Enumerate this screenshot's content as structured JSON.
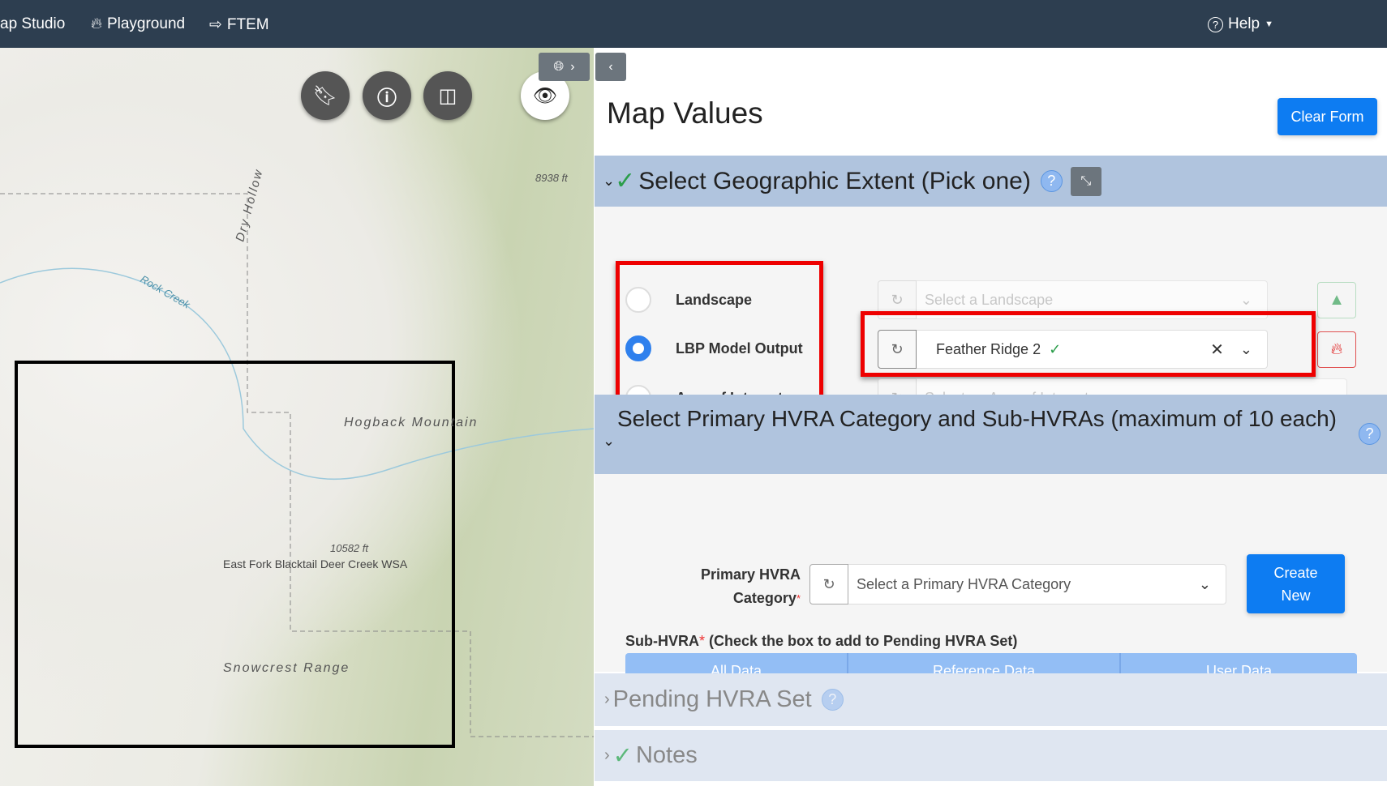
{
  "nav": {
    "items": [
      {
        "label": "ap Studio",
        "icon": ""
      },
      {
        "label": "Playground",
        "icon": "fire-icon"
      },
      {
        "label": "FTEM",
        "icon": "sign-in-icon"
      }
    ],
    "help": "Help"
  },
  "map": {
    "labels": {
      "dry_hollow": "Dry Hollow",
      "rock_creek": "Rock Creek",
      "peak1": "8938 ft",
      "hogback": "Hogback Mountain",
      "peak2": "10582 ft",
      "wsa": "East Fork Blacktail Deer Creek WSA",
      "snowcrest": "Snowcrest Range"
    }
  },
  "panel": {
    "title": "Map Values",
    "clear_form": "Clear Form",
    "geo": {
      "header": "Select Geographic Extent (Pick one)",
      "options": [
        "Landscape",
        "LBP Model Output",
        "Area of Interest"
      ],
      "selected": "LBP Model Output",
      "landscape_placeholder": "Select a Landscape",
      "lbp_value": "Feather Ridge 2",
      "aoi_placeholder": "Select an Area of Interest"
    },
    "hvra": {
      "header": "Select Primary HVRA Category and Sub-HVRAs (maximum of 10 each)",
      "primary_label_1": "Primary HVRA",
      "primary_label_2": "Category",
      "required": "*",
      "primary_placeholder": "Select a Primary HVRA Category",
      "create_new": "Create New",
      "sub_label": "Sub-HVRA",
      "sub_note": " (Check the box to add to Pending HVRA Set)",
      "tabs": [
        "All Data",
        "Reference Data",
        "User Data"
      ]
    },
    "pending": {
      "header": "Pending HVRA Set"
    },
    "notes": {
      "header": "Notes"
    }
  }
}
